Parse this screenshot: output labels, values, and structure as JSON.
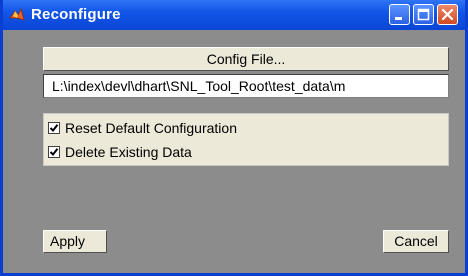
{
  "window": {
    "title": "Reconfigure",
    "icon": "matlab-figure-icon",
    "controls": {
      "minimize": "minimize-icon",
      "maximize": "maximize-icon",
      "close": "close-icon"
    }
  },
  "config": {
    "button_label": "Config File...",
    "path_value": "L:\\index\\devl\\dhart\\SNL_Tool_Root\\test_data\\m"
  },
  "options": [
    {
      "label": "Reset Default Configuration",
      "checked": true
    },
    {
      "label": "Delete Existing Data",
      "checked": true
    }
  ],
  "actions": {
    "apply_label": "Apply",
    "cancel_label": "Cancel"
  },
  "colors": {
    "titlebar": "#0a46d6",
    "client_background": "#8c8c8c",
    "control_face": "#ece9d8"
  }
}
